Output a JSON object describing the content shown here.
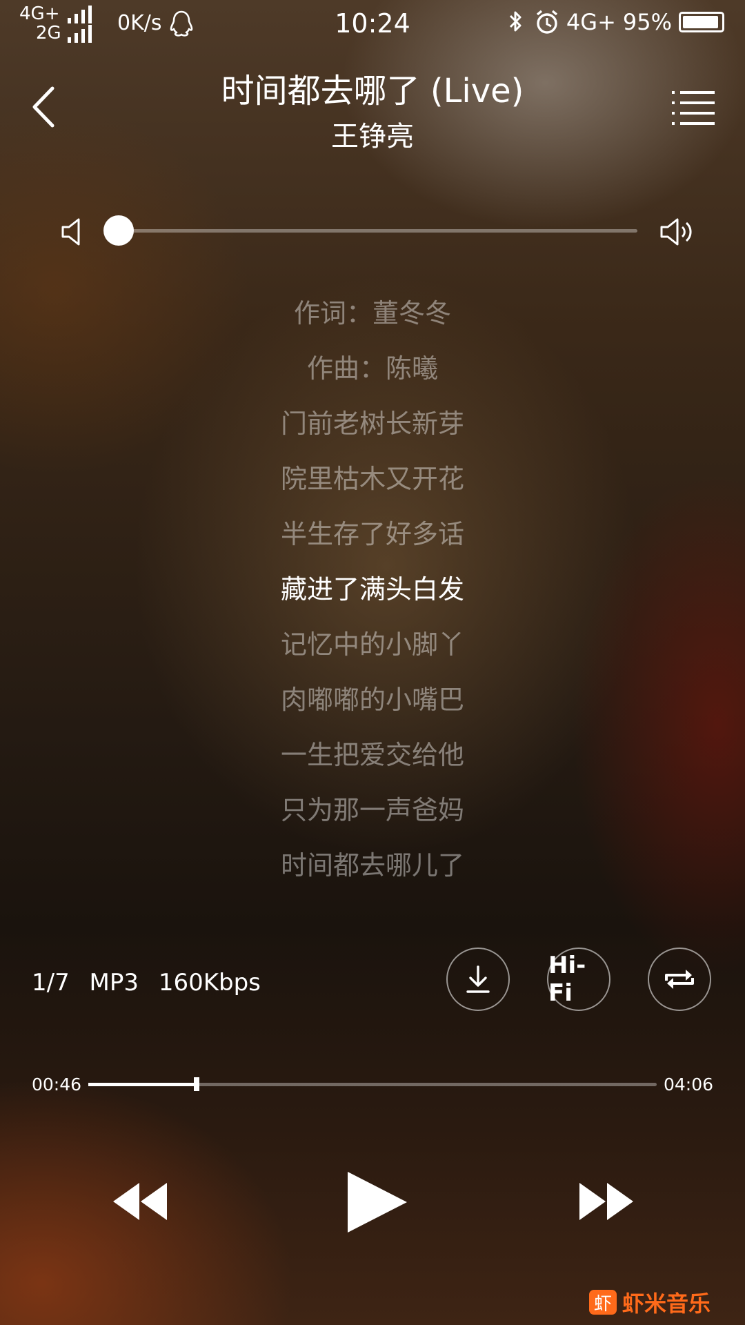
{
  "status_bar": {
    "network_top": "4G+",
    "network_bottom": "2G",
    "speed": "0K/s",
    "time": "10:24",
    "network_right": "4G+",
    "battery_percent": "95%",
    "battery_level": 0.95
  },
  "header": {
    "title": "时间都去哪了 (Live)",
    "artist": "王铮亮"
  },
  "volume": {
    "level": 0.0
  },
  "lyrics": {
    "lines": [
      "作词：董冬冬",
      "作曲：陈曦",
      "门前老树长新芽",
      "院里枯木又开花",
      "半生存了好多话",
      "藏进了满头白发",
      "记忆中的小脚丫",
      "肉嘟嘟的小嘴巴",
      "一生把爱交给他",
      "只为那一声爸妈",
      "时间都去哪儿了"
    ],
    "active_index": 5
  },
  "track_info": {
    "position": "1/7",
    "format": "MP3",
    "bitrate": "160Kbps"
  },
  "buttons": {
    "hifi_label": "Hi-Fi"
  },
  "progress": {
    "current": "00:46",
    "total": "04:06",
    "fraction": 0.19
  },
  "brand": {
    "logo_char": "虾",
    "name": "虾米音乐",
    "color": "#ff6a1a"
  }
}
